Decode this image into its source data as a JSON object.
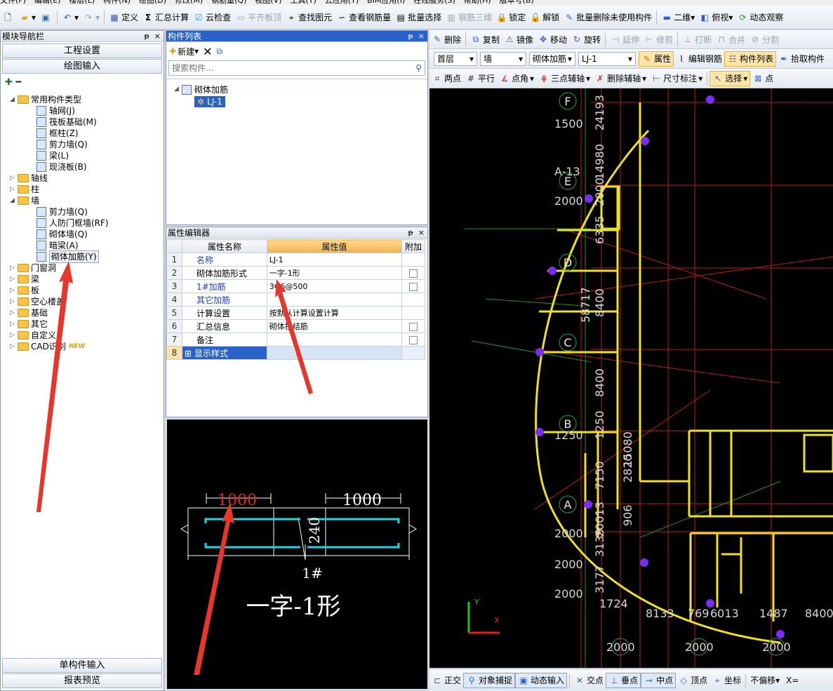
{
  "menu": [
    "文件(F)",
    "编辑(E)",
    "楼层(L)",
    "构件(N)",
    "绘图(D)",
    "修改(M)",
    "钢筋量(Q)",
    "视图(V)",
    "工具(T)",
    "云应用(Y)",
    "BIM应用(I)",
    "在线服务(S)",
    "帮助(H)",
    "版本号(B)"
  ],
  "toolbar": {
    "define": "定义",
    "summary": "汇总计算",
    "cloud_check": "云检查",
    "flat_slab_top": "平齐板顶",
    "find_element": "查找图元",
    "view_rebar_qty": "查看钢筋量",
    "batch_select": "批量选择",
    "rebar_3d": "钢筋三维",
    "lock": "锁定",
    "unlock": "解锁",
    "batch_delete_unused": "批量删除未使用构件",
    "view_2d": "二维",
    "top_view": "俯视",
    "dynamic_observe": "动态观察"
  },
  "nav": {
    "title": "模块导航栏",
    "pin": "ᵽ",
    "close": "×",
    "project_settings": "工程设置",
    "drawing_input": "绘图输入",
    "single_input": "单构件输入",
    "report_preview": "报表预览",
    "tree": {
      "common_types": "常用构件类型",
      "common_children": [
        "轴网(J)",
        "筏板基础(M)",
        "框柱(Z)",
        "剪力墙(Q)",
        "梁(L)",
        "现浇板(B)"
      ],
      "axis": "轴线",
      "column": "柱",
      "wall": "墙",
      "wall_children": [
        "剪力墙(Q)",
        "人防门框墙(RF)",
        "砌体墙(Q)",
        "暗梁(A)",
        "砌体加筋(Y)"
      ],
      "others": [
        "门窗洞",
        "梁",
        "板",
        "空心楼盖",
        "基础",
        "其它",
        "自定义",
        "CAD识别"
      ],
      "new_badge": "NEW"
    }
  },
  "component_list": {
    "title": "构件列表",
    "new_label": "新建",
    "search_placeholder": "搜索构件...",
    "root": "砌体加筋",
    "item": "LJ-1"
  },
  "prop_editor": {
    "title": "属性编辑器",
    "col_name": "属性名称",
    "col_value": "属性值",
    "col_extra": "附加",
    "rows": [
      {
        "no": "1",
        "name": "名称",
        "value": "LJ-1",
        "blue": true,
        "check": false
      },
      {
        "no": "2",
        "name": "砌体加筋形式",
        "value": "一字-1形",
        "blue": false,
        "check": true
      },
      {
        "no": "3",
        "name": "1#加筋",
        "value": "3Φ6@500",
        "blue": true,
        "check": true
      },
      {
        "no": "4",
        "name": "其它加筋",
        "value": "",
        "blue": true,
        "check": false
      },
      {
        "no": "5",
        "name": "计算设置",
        "value": "按默认计算设置计算",
        "blue": false,
        "check": false
      },
      {
        "no": "6",
        "name": "汇总信息",
        "value": "砌体拉结筋",
        "blue": false,
        "check": true
      },
      {
        "no": "7",
        "name": "备注",
        "value": "",
        "blue": false,
        "check": true
      },
      {
        "no": "8",
        "name": "显示样式",
        "value": "",
        "blue": true,
        "check": false
      }
    ]
  },
  "preview": {
    "left_len": "1000",
    "right_len": "1000",
    "thickness": "240",
    "rebar_label": "1#",
    "shape_name": "一字-1形"
  },
  "edit_toolbar": [
    "删除",
    "复制",
    "镜像",
    "移动",
    "旋转",
    "延伸",
    "修剪",
    "打断",
    "合并",
    "分割"
  ],
  "selector_bar": {
    "floor": "首层",
    "category": "墙",
    "type": "砌体加筋",
    "component": "LJ-1",
    "attr_btn": "属性",
    "edit_rebar": "编辑钢筋",
    "comp_list": "构件列表",
    "pick": "拾取构件"
  },
  "draw_toolbar": [
    "两点",
    "平行",
    "点角",
    "三点辅轴",
    "删除辅轴",
    "尺寸标注",
    "选择",
    "点"
  ],
  "status": [
    "正交",
    "对象捕捉",
    "动态输入",
    "交点",
    "垂点",
    "中点",
    "顶点",
    "坐标",
    "不偏移"
  ],
  "status_x": "X=",
  "drawing": {
    "axes": [
      "F",
      "E",
      "D",
      "C",
      "B",
      "A"
    ],
    "labels_left": [
      "1500",
      "A-13",
      "2000",
      "1250",
      "2000",
      "2000",
      "2000"
    ],
    "vertical_dims": [
      "24193",
      "14980",
      "2000",
      "6335",
      "58717",
      "8400",
      "8400",
      "1250",
      "7150",
      "20013",
      "3177",
      "3139"
    ],
    "dims_right": [
      "15080",
      "2820",
      "906"
    ],
    "bottom_dims": [
      "1724",
      "8133",
      "769",
      "6013",
      "1487",
      "8400"
    ],
    "bottom_axis": [
      "2000",
      "2000",
      "2000"
    ]
  },
  "colors": {
    "canvas_bg": "#000000",
    "wall_yellow": "#f0e020",
    "axis_red": "#d02020",
    "marker_purple": "#7a2cf0",
    "rebar_cyan": "#22d3e6"
  }
}
